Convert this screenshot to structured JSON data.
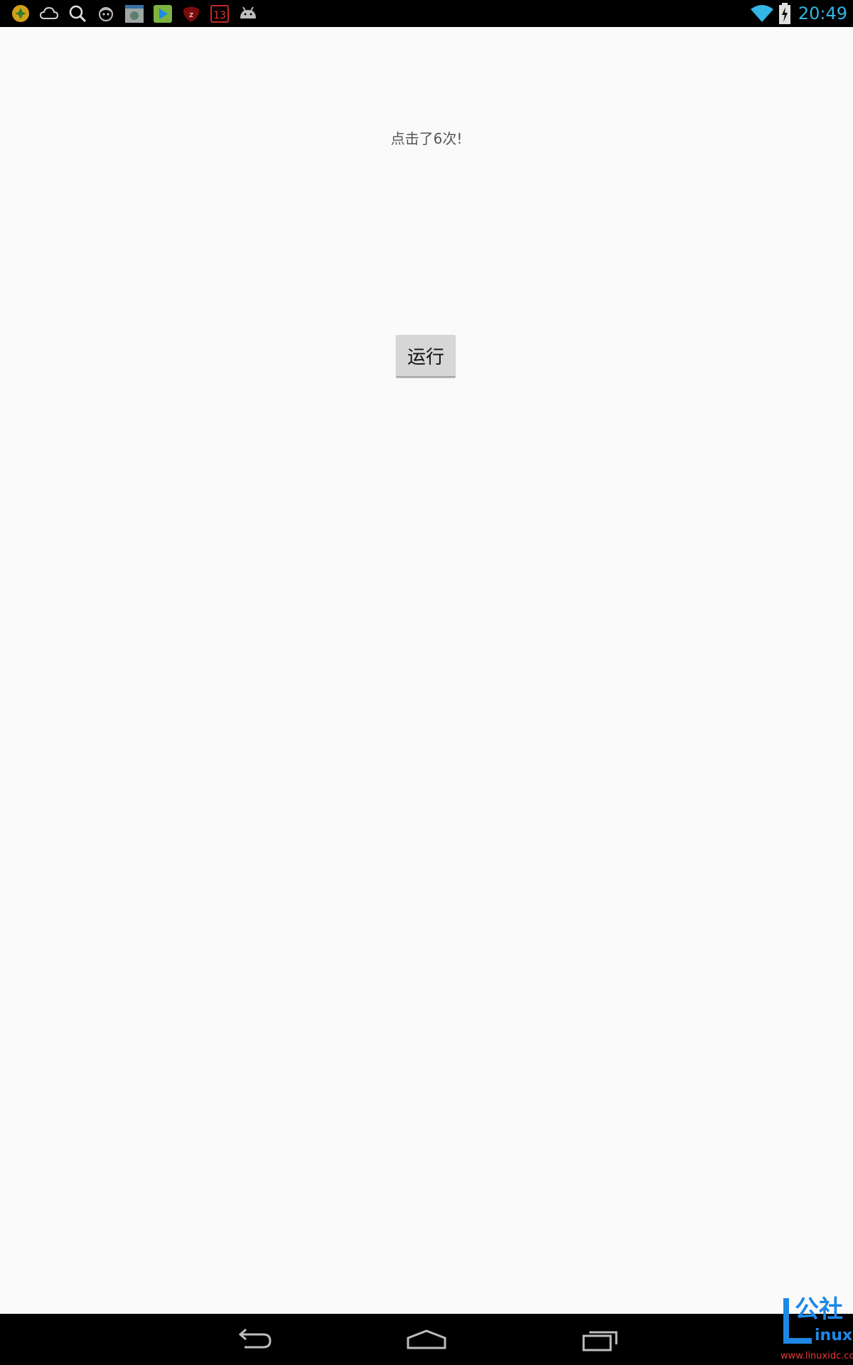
{
  "status_bar": {
    "time": "20:49",
    "notification_icons": [
      "cleaner-app-icon",
      "cloud-icon",
      "search-icon",
      "face-icon",
      "photo-app-icon",
      "play-store-icon",
      "zhihu-icon",
      "calendar-icon",
      "android-icon"
    ],
    "calendar_badge": "13",
    "zhihu_letter": "z",
    "accent_color": "#33b5e5"
  },
  "main": {
    "counter_text": "点击了6次!",
    "run_button_label": "运行"
  },
  "nav_bar": {
    "buttons": [
      "back-icon",
      "home-icon",
      "recents-icon"
    ]
  },
  "watermark": {
    "title": "公社",
    "subtitle": "inux",
    "url": "www.linuxidc.com"
  }
}
